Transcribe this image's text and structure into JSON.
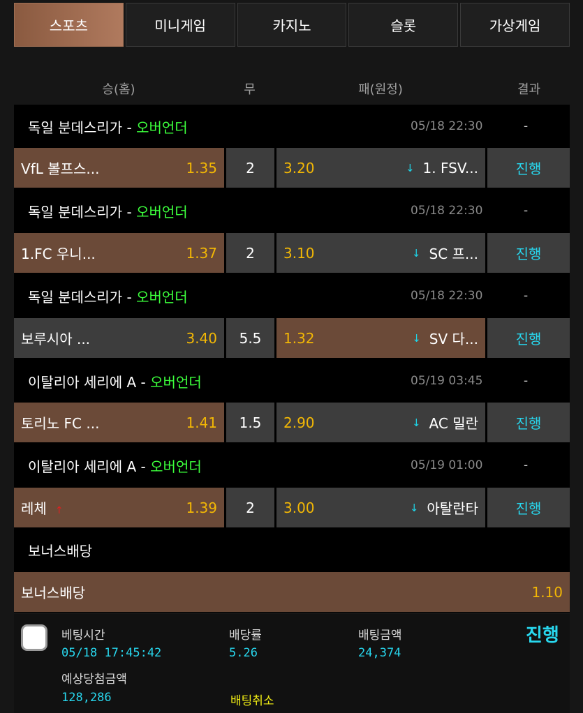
{
  "tabs": [
    "스포츠",
    "미니게임",
    "카지노",
    "슬롯",
    "가상게임"
  ],
  "columns": {
    "home": "승(홈)",
    "draw": "무",
    "away": "패(원정)",
    "result": "결과"
  },
  "matches": [
    {
      "league": "독일 분데스리가",
      "sep": " - ",
      "market": "오버언더",
      "time": "05/18 22:30",
      "result": "-",
      "home_team": "VfL 볼프스...",
      "home_odd": "1.35",
      "line": "2",
      "away_odd": "3.20",
      "away_arrow": "↓",
      "away_team": "1. FSV...",
      "status": "진행"
    },
    {
      "league": "독일 분데스리가",
      "sep": " - ",
      "market": "오버언더",
      "time": "05/18 22:30",
      "result": "-",
      "home_team": "1.FC 우니...",
      "home_odd": "1.37",
      "line": "2",
      "away_odd": "3.10",
      "away_arrow": "↓",
      "away_team": "SC 프...",
      "status": "진행"
    },
    {
      "league": "독일 분데스리가",
      "sep": " - ",
      "market": "오버언더",
      "time": "05/18 22:30",
      "result": "-",
      "home_team": "보루시아 ...",
      "home_odd": "3.40",
      "line": "5.5",
      "away_odd": "1.32",
      "away_arrow": "↓",
      "away_team": "SV 다...",
      "status": "진행"
    },
    {
      "league": "이탈리아 세리에 A",
      "sep": " - ",
      "market": "오버언더",
      "time": "05/19 03:45",
      "result": "-",
      "home_team": "토리노 FC ...",
      "home_odd": "1.41",
      "line": "1.5",
      "away_odd": "2.90",
      "away_arrow": "↓",
      "away_team": "AC 밀란",
      "status": "진행"
    },
    {
      "league": "이탈리아 세리에 A",
      "sep": " - ",
      "market": "오버언더",
      "time": "05/19 01:00",
      "result": "-",
      "home_team": "레체",
      "home_mark": "↑",
      "home_odd": "1.39",
      "line": "2",
      "away_odd": "3.00",
      "away_arrow": "↓",
      "away_team": "아탈란타",
      "status": "진행"
    }
  ],
  "bonus": {
    "header": "보너스배당",
    "label": "보너스배당",
    "odd": "1.10"
  },
  "footer": {
    "bet_time_label": "베팅시간",
    "bet_time": "05/18 17:45:42",
    "rate_label": "배당률",
    "rate": "5.26",
    "amount_label": "배팅금액",
    "amount": "24,374",
    "expected_label": "예상당첨금액",
    "expected": "128,286",
    "cancel_label": "배팅취소",
    "status": "진행"
  },
  "colors": {
    "accent": "#28d7ee",
    "odd": "#f2b705",
    "market": "#3cff3c",
    "selected": "#6b4a38",
    "cancel": "#f2ee14"
  }
}
